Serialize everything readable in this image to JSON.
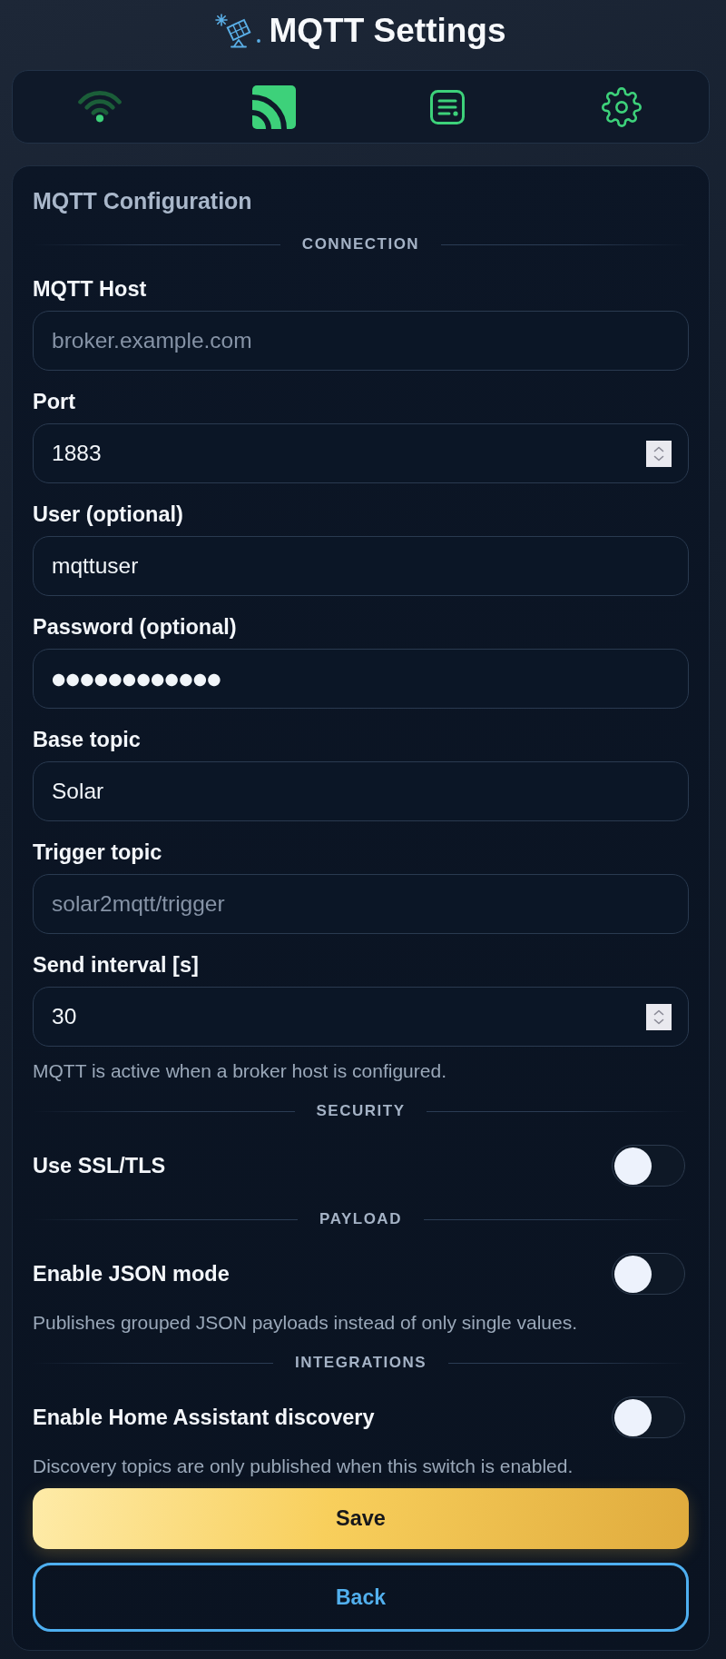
{
  "header": {
    "title": "MQTT Settings"
  },
  "tabs": [
    {
      "selected": false
    },
    {
      "selected": true
    },
    {
      "selected": false
    },
    {
      "selected": false
    }
  ],
  "card": {
    "title": "MQTT Configuration",
    "sections": [
      {
        "heading": "CONNECTION",
        "items": [
          {
            "kind": "text_field",
            "label": "MQTT Host",
            "placeholder": "broker.example.com"
          },
          {
            "kind": "number_field",
            "label": "Port",
            "value": "1883"
          },
          {
            "kind": "text_field",
            "label": "User (optional)",
            "value": "mqttuser"
          },
          {
            "kind": "password_field",
            "label": "Password (optional)",
            "value": "●●●●●●●●●●●●"
          },
          {
            "kind": "text_field",
            "label": "Base topic",
            "value": "Solar"
          },
          {
            "kind": "text_field",
            "label": "Trigger topic",
            "placeholder": "solar2mqtt/trigger"
          },
          {
            "kind": "number_field",
            "label": "Send interval [s]",
            "value": "30"
          },
          {
            "kind": "note",
            "text": "MQTT is active when a broker host is configured."
          }
        ]
      },
      {
        "heading": "SECURITY",
        "items": [
          {
            "kind": "switch",
            "label": "Use SSL/TLS",
            "on": false
          }
        ]
      },
      {
        "heading": "PAYLOAD",
        "items": [
          {
            "kind": "switch",
            "label": "Enable JSON mode",
            "on": false
          },
          {
            "kind": "note",
            "text": "Publishes grouped JSON payloads instead of only single values."
          }
        ]
      },
      {
        "heading": "INTEGRATIONS",
        "items": [
          {
            "kind": "switch",
            "label": "Enable Home Assistant discovery",
            "on": false
          },
          {
            "kind": "note",
            "text": "Discovery topics are only published when this switch is enabled."
          }
        ]
      }
    ],
    "buttons": [
      {
        "kind": "primary",
        "label": "Save"
      },
      {
        "kind": "outline",
        "label": "Back"
      }
    ]
  }
}
